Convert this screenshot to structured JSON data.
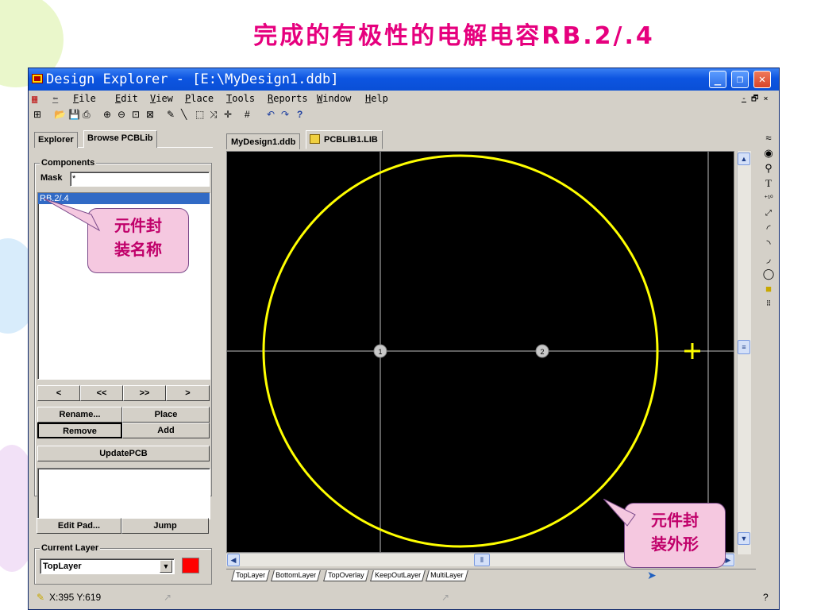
{
  "slide": {
    "title": "完成的有极性的电解电容RB.2/.4"
  },
  "window": {
    "title": "Design Explorer - [E:\\MyDesign1.ddb]"
  },
  "menu": {
    "items": [
      "File",
      "Edit",
      "View",
      "Place",
      "Tools",
      "Reports",
      "Window",
      "Help"
    ],
    "mdi_controls": "- 🗗 ×"
  },
  "left_panel": {
    "tabs": [
      "Explorer",
      "Browse PCBLib"
    ],
    "components_label": "Components",
    "mask_label": "Mask",
    "mask_value": "*",
    "component_list": [
      "RB.2/.4"
    ],
    "nav_buttons": [
      "<",
      "<<",
      ">>",
      ">"
    ],
    "buttons": {
      "rename": "Rename...",
      "place": "Place",
      "remove": "Remove",
      "add": "Add",
      "update_pcb": "UpdatePCB",
      "edit_pad": "Edit Pad...",
      "jump": "Jump"
    },
    "current_layer_label": "Current Layer",
    "current_layer_value": "TopLayer",
    "layer_color": "#ff0000"
  },
  "document_tabs": [
    "MyDesign1.ddb",
    "PCBLIB1.LIB"
  ],
  "canvas": {
    "pads": [
      "1",
      "2"
    ],
    "outline_color": "#ffff00",
    "background": "#000000"
  },
  "layer_tabs": [
    "TopLayer",
    "BottomLayer",
    "TopOverlay",
    "KeepOutLayer",
    "MultiLayer"
  ],
  "callouts": {
    "name": "元件封装名称",
    "outline": "元件封装外形"
  },
  "status": {
    "coords": "X:395 Y:619"
  }
}
